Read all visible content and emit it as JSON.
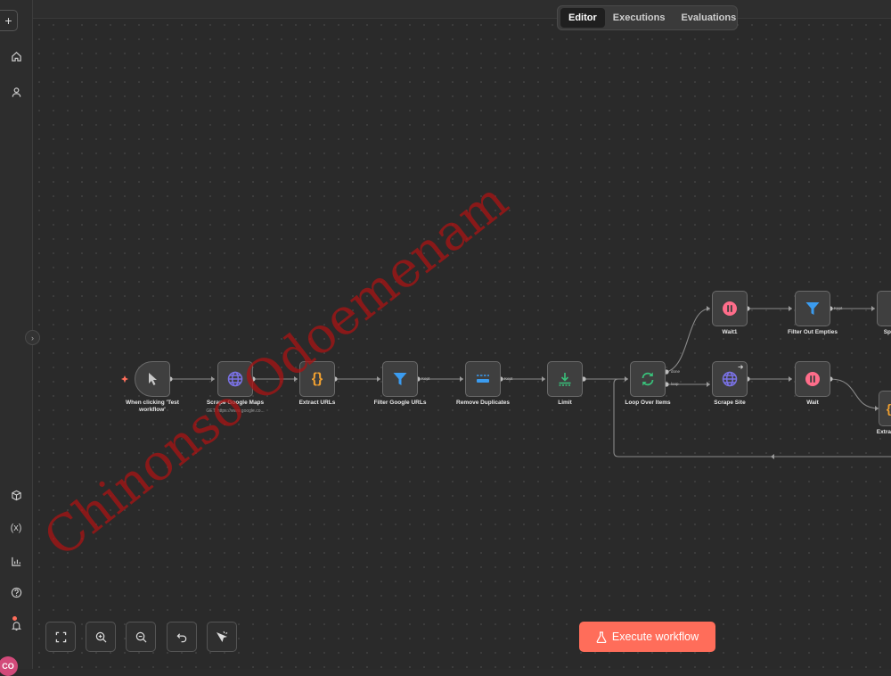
{
  "tabs": {
    "editor": "Editor",
    "executions": "Executions",
    "evaluations": "Evaluations"
  },
  "sidebar": {
    "add": "+",
    "avatar_initials": "CO",
    "collapse": "›"
  },
  "nodes": {
    "trigger": {
      "label_1": "When clicking 'Test",
      "label_2": "workflow'"
    },
    "scrape_maps": {
      "label": "Scrape Google Maps",
      "sub": "GET: https://www.google.co..."
    },
    "extract_urls": {
      "label": "Extract URLs"
    },
    "filter_google": {
      "label": "Filter Google URLs"
    },
    "remove_dupes": {
      "label": "Remove Duplicates"
    },
    "limit": {
      "label": "Limit"
    },
    "loop": {
      "label": "Loop Over Items"
    },
    "wait1": {
      "label": "Wait1"
    },
    "filter_empties": {
      "label": "Filter Out Empties"
    },
    "split": {
      "label": "Sp"
    },
    "scrape_site": {
      "label": "Scrape Site"
    },
    "wait": {
      "label": "Wait"
    },
    "extract2": {
      "label": "Extra"
    }
  },
  "edge_labels": {
    "kept1": "Kept",
    "kept2": "Kept",
    "kept3": "Kept",
    "done": "done",
    "loop": "loop"
  },
  "toolbar": {
    "execute_label": "Execute workflow"
  },
  "watermark": "Chinonso Odoemenam",
  "colors": {
    "accent": "#ff6d5a",
    "purple": "#7a72e6",
    "blue": "#3b9cf0",
    "orange": "#f0a030",
    "green": "#39c07a",
    "pink": "#ff6d8a"
  }
}
